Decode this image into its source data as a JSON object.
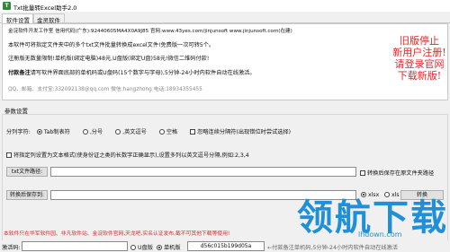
{
  "window": {
    "title": "Txt批量转Excel助手2.0",
    "icon_label": "T"
  },
  "tabs": [
    {
      "label": "软件设置"
    },
    {
      "label": "金灵软件"
    }
  ],
  "info": {
    "line1": "金淀软件开发工作室  信用代码(广东):92440605MA4X0A9J85  官网:www.43yes.com/jinjunsoft  www.jinjunsoft.com(在建)",
    "line2": "本软件可将指定文件夹中的多个txt文件批量转换成excel文件!免费版一次可转5个。",
    "line3": "注册版无数量限制!单机版(绑定电脑)48元,U盘版(绑定U盘)58元!微信二维码付款!",
    "line4_bold": "付款备注",
    "line4_rest": "请写软件界面底部的单机码或U盘码(15个数字与字母),5分钟-24小时内软件自动在线激活。",
    "line5": "QQ、邮箱、支付宝:332092138@qq.com    微信:hangzhong    电话:18934355455"
  },
  "promo": {
    "lines": [
      "旧版停止",
      "新用户注册!",
      "请登录官网",
      "下载新版!"
    ]
  },
  "settings": {
    "section_label": "参数设置",
    "delimiter_label": "分列字符:",
    "delimiters": [
      {
        "label": "Tab制表符",
        "selected": true
      },
      {
        "label": ",分号",
        "selected": false
      },
      {
        "label": ",英文逗号",
        "selected": false
      },
      {
        "label": "空格",
        "selected": false
      }
    ],
    "ignore_consecutive": "忽略连续分隔符(出现错位时尝试选择)",
    "text_format_label": "将指定列设置为文本格式(使身份证之类的长数字正确显示),设置多列以英文逗号分隔,例如:2,3,4",
    "txt_path_button": "txt文件路径:",
    "save_excel_checkbox": "转换后保存在原文件夹路径",
    "output_button": "转换后保存到:",
    "format_options": [
      {
        "label": "xlsx",
        "selected": true
      },
      {
        "label": "xls",
        "selected": false
      }
    ],
    "convert_button": "转换"
  },
  "footer": {
    "note": "本软件只在华军软件园、非凡软件站、金淀软件官网,天龙吧,实名认证发布,截不可其他下载等使用!",
    "activation_label": "激活码:",
    "activation_options": [
      {
        "label": "U盘版",
        "selected": false
      },
      {
        "label": "单机版",
        "selected": true
      }
    ],
    "machine_code": "d56c015b199d05a",
    "tip": "←付款备注单机码,5分钟-24小时内软件自动在线激活"
  },
  "watermark": {
    "text": "领航下载",
    "sub": "lhdown.com"
  },
  "colors": {
    "accent_red": "#e0262a",
    "watermark_blue": "#1f8fd8"
  }
}
